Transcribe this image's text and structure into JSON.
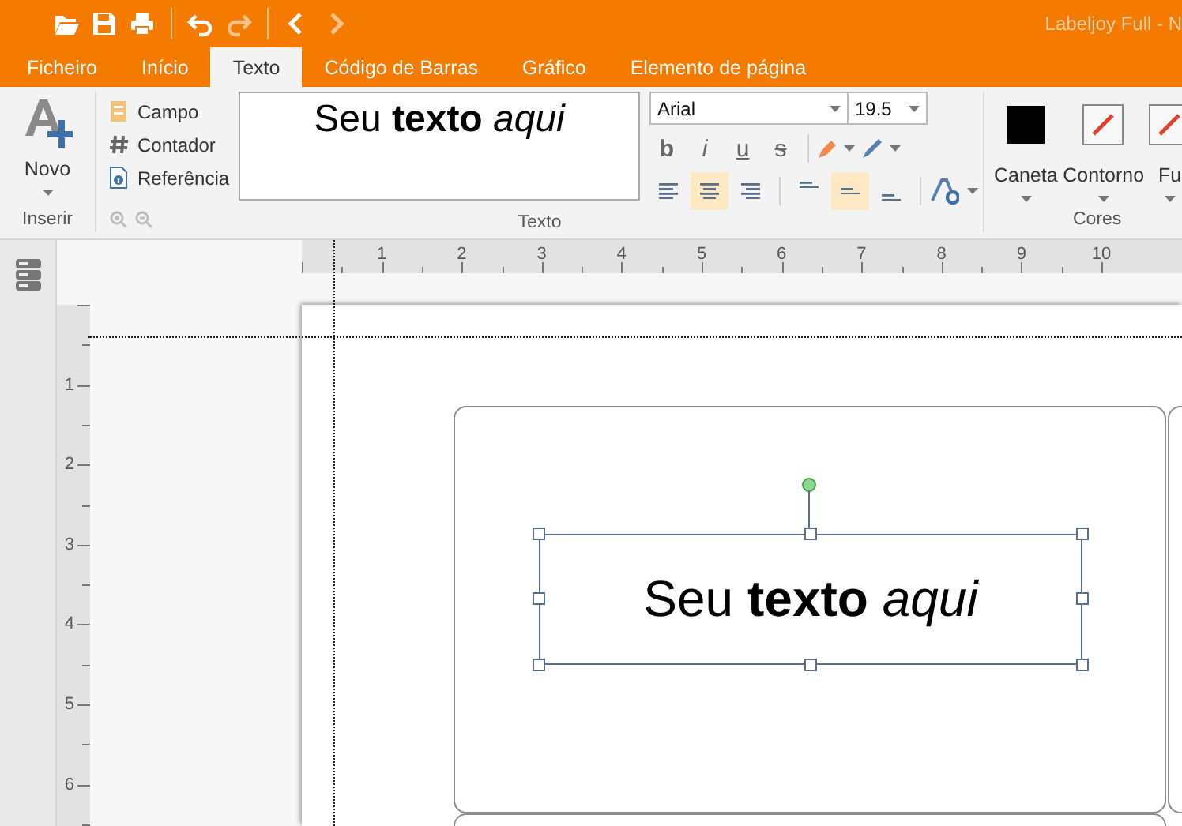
{
  "window": {
    "title": "Labeljoy Full - N"
  },
  "quick_access": [
    {
      "disabled": false
    },
    {
      "disabled": false
    },
    {
      "disabled": false
    },
    {
      "disabled": false
    },
    {
      "disabled": true
    },
    {
      "disabled": false
    },
    {
      "disabled": true
    }
  ],
  "tabs": [
    {
      "label": "Ficheiro",
      "selected": false
    },
    {
      "label": "Início",
      "selected": false
    },
    {
      "label": "Texto",
      "selected": true
    },
    {
      "label": "Código de Barras",
      "selected": false
    },
    {
      "label": "Gráfico",
      "selected": false
    },
    {
      "label": "Elemento de página",
      "selected": false
    }
  ],
  "ribbon": {
    "inserir": {
      "label": "Inserir",
      "new_button": "Novo",
      "items": [
        "Campo",
        "Contador",
        "Referência"
      ]
    },
    "texto": {
      "label": "Texto",
      "preview": "Seu **texto** *aqui*",
      "font": "Arial",
      "size": "19.5",
      "format_buttons": [
        {
          "glyph": "b",
          "selected": false
        },
        {
          "glyph": "i",
          "selected": false
        },
        {
          "glyph": "u",
          "selected": false
        },
        {
          "glyph": "s",
          "selected": false
        }
      ],
      "align_buttons": [
        {
          "kind": "left",
          "selected": false
        },
        {
          "kind": "center",
          "selected": true
        },
        {
          "kind": "right",
          "selected": false
        }
      ],
      "vertical_buttons": [
        {
          "kind": "top",
          "selected": false
        },
        {
          "kind": "middle",
          "selected": true
        },
        {
          "kind": "bottom",
          "selected": false
        }
      ]
    },
    "cores": {
      "label": "Cores",
      "swatches": [
        {
          "label": "Caneta",
          "kind": "solid",
          "color": "#000000"
        },
        {
          "label": "Contorno",
          "kind": "none"
        },
        {
          "label": "Fu",
          "kind": "none"
        }
      ]
    }
  },
  "rulers": {
    "horizontal": [
      "1",
      "2",
      "3",
      "4",
      "5",
      "6",
      "7",
      "8",
      "9",
      "10"
    ],
    "vertical": [
      "1",
      "2",
      "3",
      "4",
      "5",
      "6"
    ]
  },
  "canvas": {
    "text_object": "Seu **texto** *aqui*"
  }
}
